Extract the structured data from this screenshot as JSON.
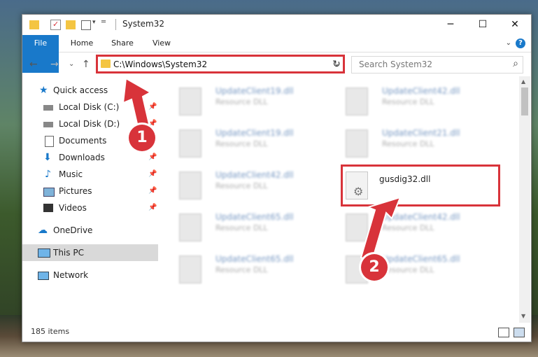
{
  "window": {
    "title": "System32"
  },
  "ribbon": {
    "tabs": [
      "File",
      "Home",
      "Share",
      "View"
    ]
  },
  "navigation": {
    "address": "C:\\Windows\\System32",
    "search_placeholder": "Search System32"
  },
  "sidebar": {
    "items": [
      {
        "label": "Quick access",
        "icon": "star-icon",
        "pinned": false
      },
      {
        "label": "Local Disk (C:)",
        "icon": "drive-icon",
        "pinned": true
      },
      {
        "label": "Local Disk (D:)",
        "icon": "drive-icon",
        "pinned": true
      },
      {
        "label": "Documents",
        "icon": "document-icon",
        "pinned": true
      },
      {
        "label": "Downloads",
        "icon": "download-icon",
        "pinned": true
      },
      {
        "label": "Music",
        "icon": "music-icon",
        "pinned": true
      },
      {
        "label": "Pictures",
        "icon": "pictures-icon",
        "pinned": true
      },
      {
        "label": "Videos",
        "icon": "video-icon",
        "pinned": true
      },
      {
        "label": "OneDrive",
        "icon": "cloud-icon",
        "pinned": false
      },
      {
        "label": "This PC",
        "icon": "computer-icon",
        "pinned": false,
        "selected": true
      },
      {
        "label": "Network",
        "icon": "network-icon",
        "pinned": false
      }
    ]
  },
  "files": [
    {
      "name": "UpdateClient19.dll",
      "type": "Resource DLL"
    },
    {
      "name": "UpdateClient42.dll",
      "type": "Resource DLL"
    },
    {
      "name": "UpdateClient19.dll",
      "type": "Resource DLL"
    },
    {
      "name": "UpdateClient21.dll",
      "type": "Resource DLL"
    },
    {
      "name": "UpdateClient42.dll",
      "type": "Resource DLL"
    },
    {
      "name": "gusdig32.dll",
      "type": ""
    },
    {
      "name": "UpdateClient65.dll",
      "type": "Resource DLL"
    },
    {
      "name": "UpdateClient42.dll",
      "type": "Resource DLL"
    },
    {
      "name": "UpdateClient65.dll",
      "type": "Resource DLL"
    },
    {
      "name": "UpdateClient65.dll",
      "type": "Resource DLL"
    }
  ],
  "status": {
    "item_count": "185 items"
  },
  "annotations": {
    "step1": "1",
    "step2": "2",
    "highlight_color": "#d8333a"
  }
}
